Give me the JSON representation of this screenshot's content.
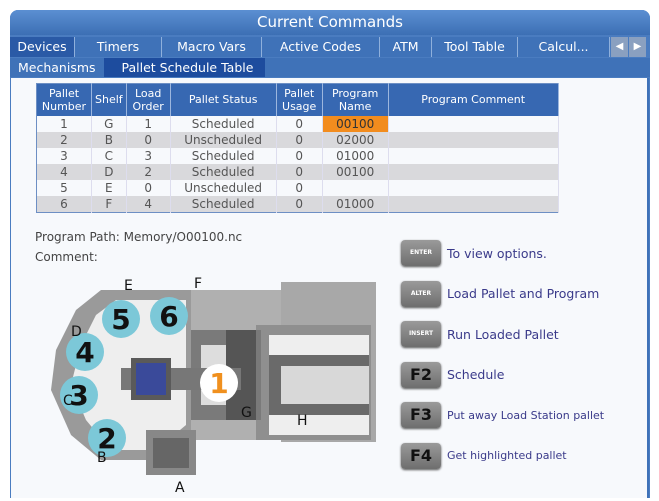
{
  "window": {
    "title": "Current Commands"
  },
  "tabs": [
    {
      "label": "Devices",
      "active": false
    },
    {
      "label": "Timers"
    },
    {
      "label": "Macro Vars"
    },
    {
      "label": "Active Codes"
    },
    {
      "label": "ATM"
    },
    {
      "label": "Tool Table"
    },
    {
      "label": "Calcul..."
    }
  ],
  "subtabs": [
    {
      "label": "Mechanisms"
    },
    {
      "label": "Pallet Schedule Table",
      "active": true
    }
  ],
  "table": {
    "headers": [
      "Pallet Number",
      "Shelf",
      "Load Order",
      "Pallet Status",
      "Pallet Usage",
      "Program Name",
      "Program Comment"
    ],
    "rows": [
      [
        "1",
        "G",
        "1",
        "Scheduled",
        "0",
        "00100",
        ""
      ],
      [
        "2",
        "B",
        "0",
        "Unscheduled",
        "0",
        "02000",
        ""
      ],
      [
        "3",
        "C",
        "3",
        "Scheduled",
        "0",
        "01000",
        ""
      ],
      [
        "4",
        "D",
        "2",
        "Scheduled",
        "0",
        "00100",
        ""
      ],
      [
        "5",
        "E",
        "0",
        "Unscheduled",
        "0",
        "",
        ""
      ],
      [
        "6",
        "F",
        "4",
        "Scheduled",
        "0",
        "01000",
        ""
      ]
    ],
    "highlight_color": "#f28c1e"
  },
  "info": {
    "program_path": "Program Path: Memory/O00100.nc",
    "comment": "Comment:"
  },
  "actions": [
    {
      "key": "ENTER",
      "label": "To view options."
    },
    {
      "key": "ALTER",
      "label": "Load Pallet and Program"
    },
    {
      "key": "INSERT",
      "label": "Run Loaded Pallet"
    },
    {
      "key": "F2",
      "label": "Schedule"
    },
    {
      "key": "F3",
      "label": "Put away Load Station pallet"
    },
    {
      "key": "F4",
      "label": "Get highlighted pallet"
    }
  ],
  "diagram": {
    "shelves": [
      "A",
      "B",
      "C",
      "D",
      "E",
      "F",
      "G",
      "H"
    ],
    "pallets": [
      "1",
      "2",
      "3",
      "4",
      "5",
      "6"
    ]
  }
}
